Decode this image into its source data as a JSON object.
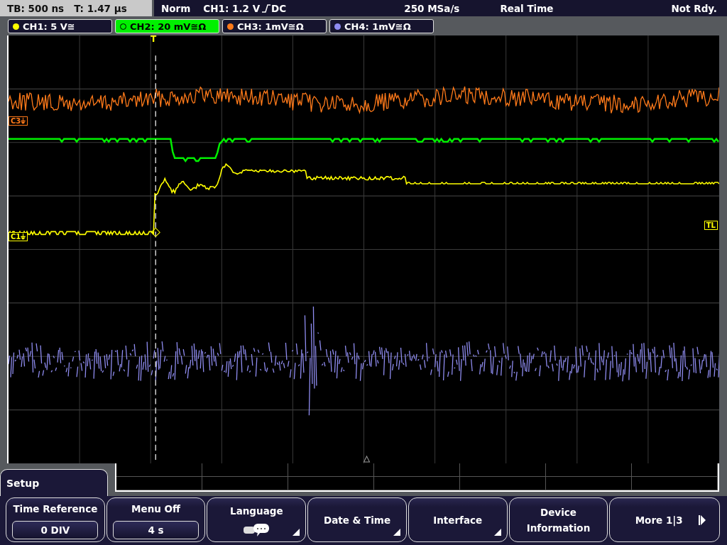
{
  "status_bar": {
    "timebase": "TB: 500 ns",
    "trigger_time": "T: 1.47 µs",
    "mode": "Norm",
    "trigger_level": "CH1: 1.2 V",
    "coupling": "DC",
    "sample_rate": "250 MSa/s",
    "acquisition": "Real Time",
    "state": "Not Rdy."
  },
  "channels": [
    {
      "label": "CH1: 5 V≅",
      "color": "#ffff00",
      "selected": false
    },
    {
      "label": "CH2: 20 mV≅Ω",
      "color": "#00ee00",
      "selected": true
    },
    {
      "label": "CH3: 1mV≅Ω",
      "color": "#ff7a1a",
      "selected": false
    },
    {
      "label": "CH4: 1mV≅Ω",
      "color": "#8f8cf0",
      "selected": false
    }
  ],
  "plot": {
    "trigger_marker": "T",
    "trigger_level_marker": "TL",
    "channel_markers": [
      {
        "label": "C3⏚",
        "color": "#ff7a1a"
      },
      {
        "label": "C1⏚",
        "color": "#ffff00"
      }
    ]
  },
  "menu": {
    "title": "Setup",
    "softkeys": [
      {
        "kind": "value",
        "label": "Time Reference",
        "value": "0 DIV"
      },
      {
        "kind": "value",
        "label": "Menu Off",
        "value": "4 s"
      },
      {
        "kind": "icon",
        "label": "Language",
        "submenu": true
      },
      {
        "kind": "text",
        "label": "Date & Time",
        "submenu": true
      },
      {
        "kind": "text",
        "label": "Interface",
        "submenu": true
      },
      {
        "kind": "text",
        "label": "Device Information",
        "submenu": false
      },
      {
        "kind": "more",
        "label": "More 1|3"
      }
    ]
  }
}
